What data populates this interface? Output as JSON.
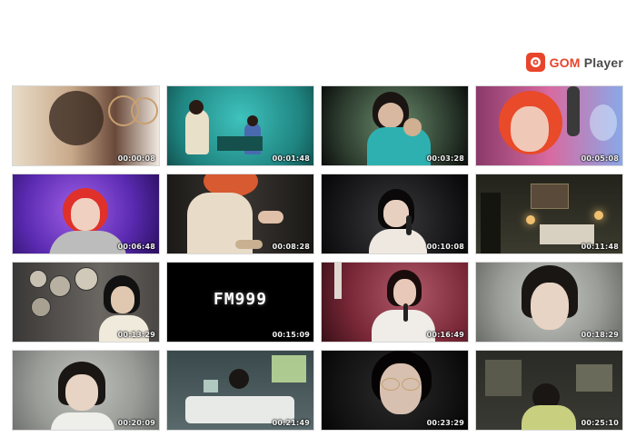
{
  "brand": {
    "name_primary": "GOM",
    "name_secondary": "Player",
    "accent": "#e8452c"
  },
  "thumbnails": [
    {
      "timestamp": "00:00:08",
      "bg": "#d8c8b8"
    },
    {
      "timestamp": "00:01:48",
      "bg": "#2fa3a0"
    },
    {
      "timestamp": "00:03:28",
      "bg": "#4a6a55"
    },
    {
      "timestamp": "00:05:08",
      "bg": "#c15a9a"
    },
    {
      "timestamp": "00:06:48",
      "bg": "#6a3cc0"
    },
    {
      "timestamp": "00:08:28",
      "bg": "#3a3530"
    },
    {
      "timestamp": "00:10:08",
      "bg": "#1a1a1c"
    },
    {
      "timestamp": "00:11:48",
      "bg": "#2a2a22"
    },
    {
      "timestamp": "00:13:29",
      "bg": "#555350"
    },
    {
      "timestamp": "00:15:09",
      "bg": "#000000",
      "title_text": "FM999"
    },
    {
      "timestamp": "00:16:49",
      "bg": "#8a3a48"
    },
    {
      "timestamp": "00:18:29",
      "bg": "#a8aaa5"
    },
    {
      "timestamp": "00:20:09",
      "bg": "#9a9c98"
    },
    {
      "timestamp": "00:21:49",
      "bg": "#4a5a5c"
    },
    {
      "timestamp": "00:23:29",
      "bg": "#1e1e1e"
    },
    {
      "timestamp": "00:25:10",
      "bg": "#2a2a26"
    }
  ]
}
